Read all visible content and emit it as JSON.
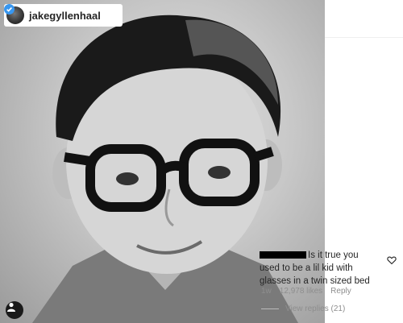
{
  "post": {
    "username": "jakegyllenhaal",
    "verified": true
  },
  "comment": {
    "text": "Is it true you used to be a lil kid with glasses in a twin sized bed",
    "time": "1w",
    "likes": "12,978 likes",
    "reply_label": "Reply",
    "view_replies": "View replies (21)"
  },
  "icons": {
    "verified": "verified-badge-icon",
    "heart": "heart-icon",
    "tag": "user-tag-icon"
  },
  "colors": {
    "verified_blue": "#3897f0",
    "meta_gray": "#8e8e8e",
    "text": "#262626"
  }
}
